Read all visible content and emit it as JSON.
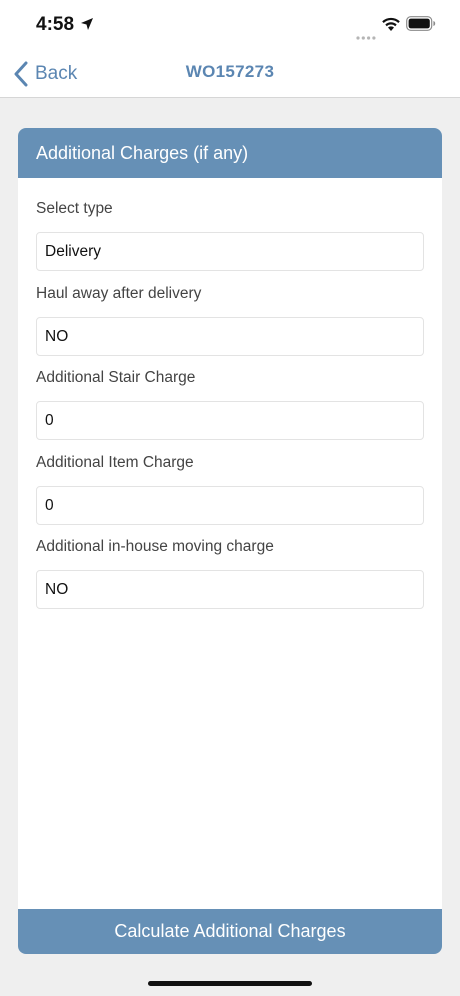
{
  "status_bar": {
    "time": "4:58"
  },
  "nav": {
    "back_label": "Back",
    "title": "WO157273"
  },
  "card": {
    "header": "Additional Charges (if any)",
    "fields": [
      {
        "label": "Select type",
        "value": "Delivery"
      },
      {
        "label": "Haul away after delivery",
        "value": "NO"
      },
      {
        "label": "Additional Stair Charge",
        "value": "0"
      },
      {
        "label": "Additional Item Charge",
        "value": "0"
      },
      {
        "label": "Additional in-house moving charge",
        "value": "NO"
      }
    ],
    "button_label": "Calculate Additional Charges"
  },
  "colors": {
    "accent": "#6690b6",
    "link": "#5b86b2",
    "background": "#efefef"
  },
  "icons": [
    "location-arrow-icon",
    "cellular-signal-icon",
    "wifi-icon",
    "battery-icon",
    "chevron-left-icon"
  ]
}
